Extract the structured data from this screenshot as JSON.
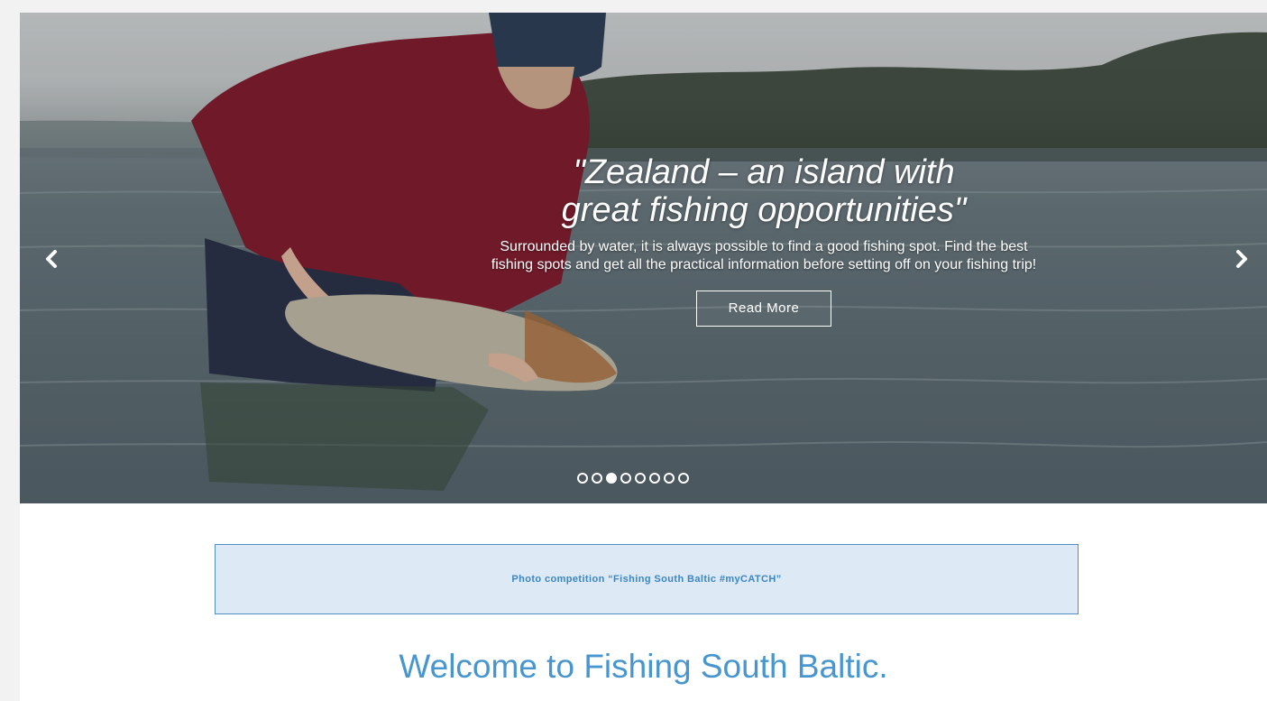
{
  "slider": {
    "title_line1": "\"Zealand – an island with",
    "title_line2": "great fishing opportunities\"",
    "text_line1": "Surrounded by water, it is always possible to find a good fishing spot. Find the best",
    "text_line2": "fishing spots and get all the practical information before setting off on your fishing trip!",
    "button_label": "Read More",
    "slide_count": 8,
    "active_slide": 3,
    "prev_icon": "chevron-left-icon",
    "next_icon": "chevron-right-icon"
  },
  "banner": {
    "label": "Photo competition “Fishing South Baltic #myCATCH”"
  },
  "welcome": {
    "heading": "Welcome to Fishing South Baltic."
  },
  "colors": {
    "accent_blue": "#4796d0",
    "banner_bg": "#dde9f5",
    "banner_border": "#4f8fc4",
    "banner_text": "#3b86c4"
  }
}
